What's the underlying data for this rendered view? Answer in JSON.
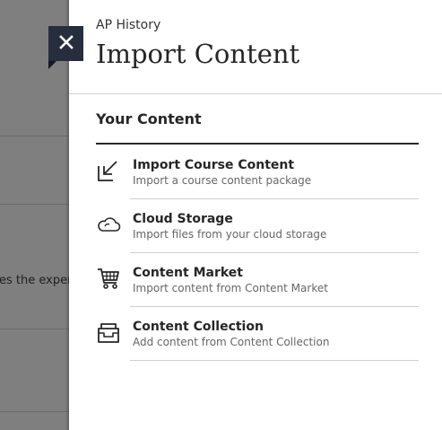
{
  "background": {
    "partial_text": "es the exper"
  },
  "panel": {
    "course_name": "AP History",
    "title": "Import Content",
    "close_icon": "close-icon",
    "section_title": "Your Content",
    "options": [
      {
        "icon": "import-arrow-icon",
        "label": "Import Course Content",
        "description": "Import a course content package"
      },
      {
        "icon": "cloud-icon",
        "label": "Cloud Storage",
        "description": "Import files from your cloud storage"
      },
      {
        "icon": "shopping-cart-icon",
        "label": "Content Market",
        "description": "Import content from Content Market"
      },
      {
        "icon": "inbox-tray-icon",
        "label": "Content Collection",
        "description": "Add content from Content Collection"
      }
    ]
  },
  "colors": {
    "close_button": "#262d3d",
    "overlay": "#7f7f7f",
    "text_primary": "#262626",
    "text_secondary": "#666666"
  }
}
